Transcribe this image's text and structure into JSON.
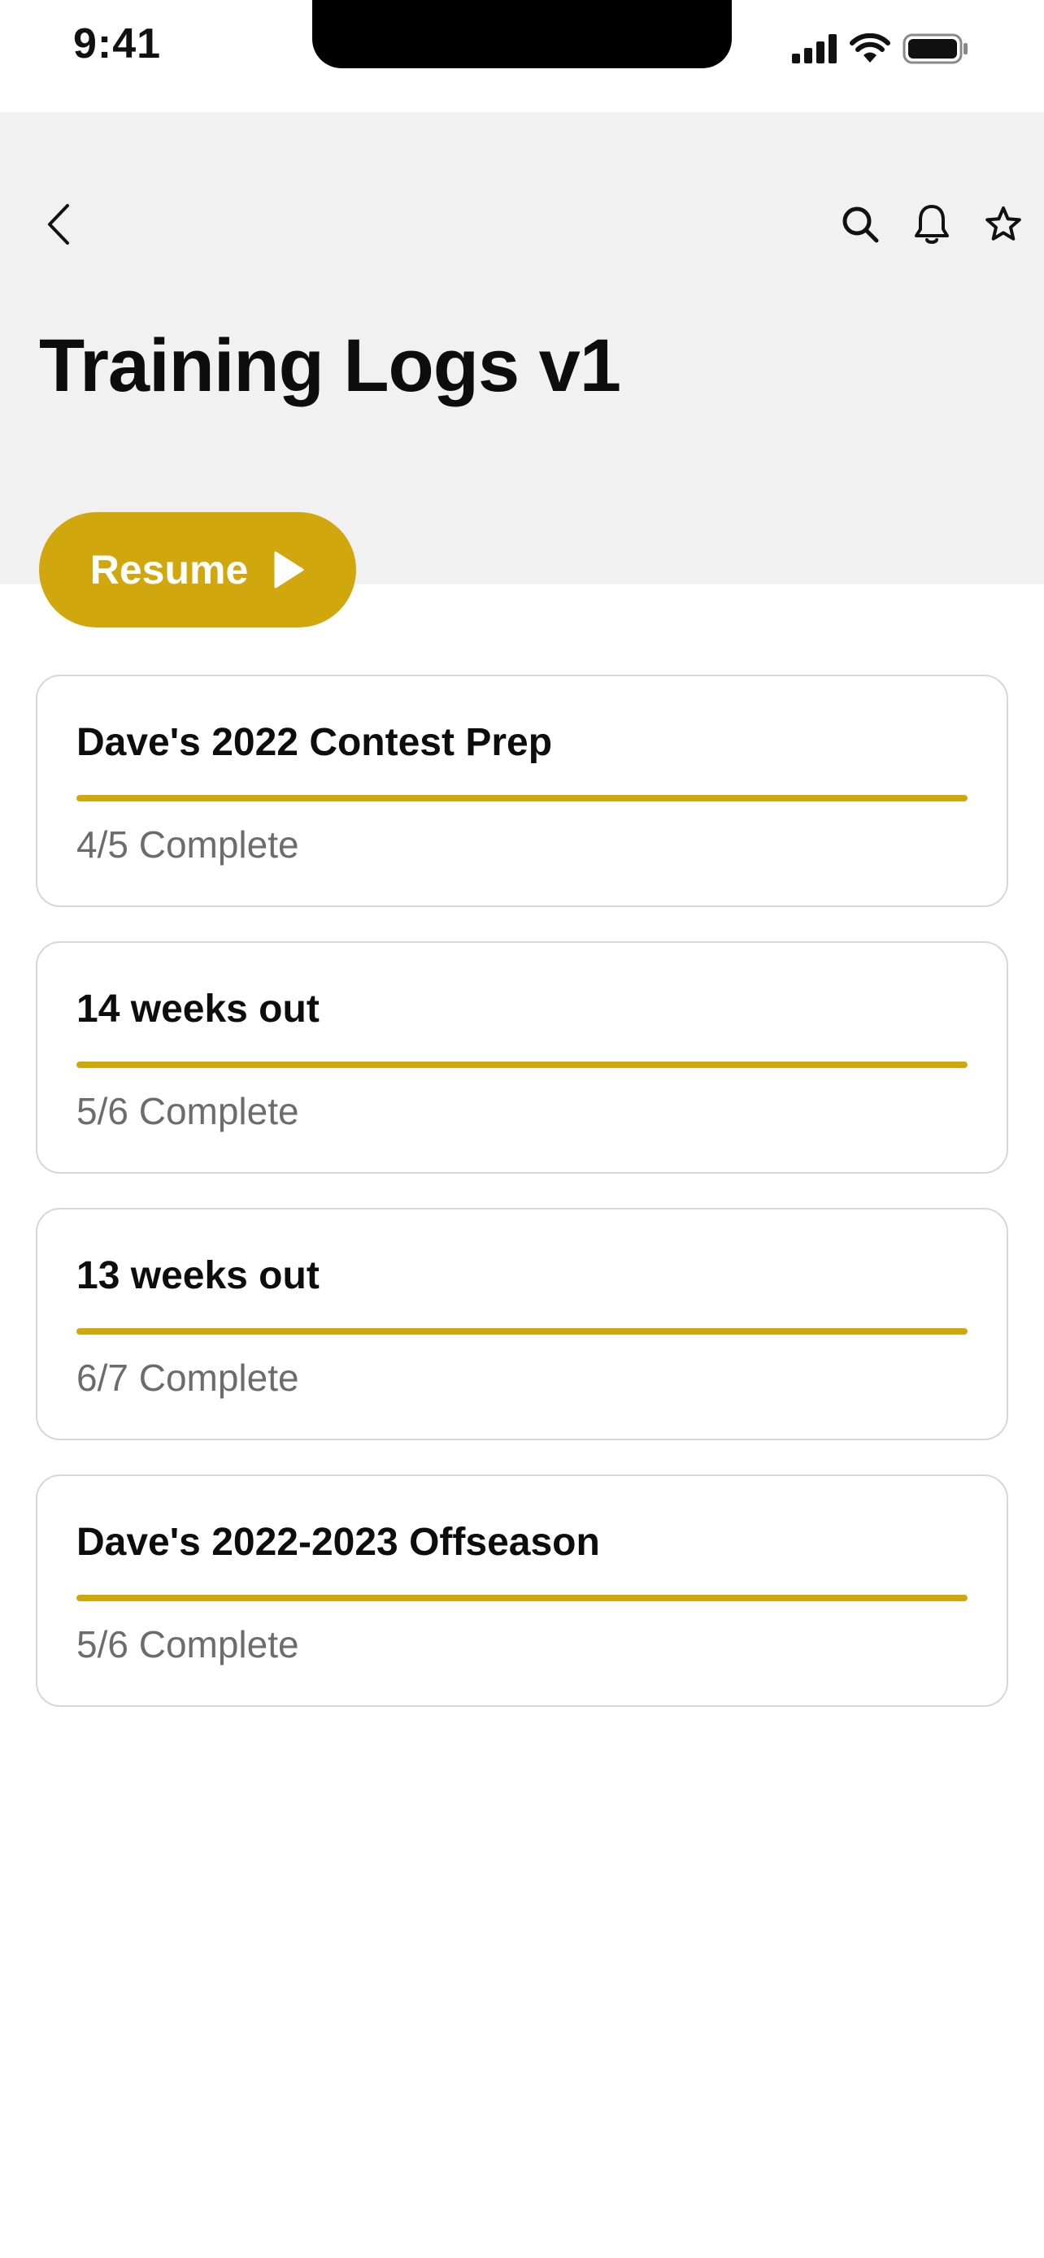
{
  "status_bar": {
    "time": "9:41"
  },
  "header": {
    "title": "Training Logs v1"
  },
  "resume": {
    "label": "Resume"
  },
  "colors": {
    "accent": "#d1a70e",
    "header_bg": "#f1f1f1",
    "muted_text": "#6c6c6c"
  },
  "icons": {
    "back": "chevron-left-icon",
    "search": "search-icon",
    "notifications": "bell-icon",
    "favorite": "star-icon",
    "resume": "play-icon"
  },
  "logs": [
    {
      "title": "Dave's 2022 Contest Prep",
      "status": "4/5 Complete",
      "progress": 1.0
    },
    {
      "title": "14 weeks out",
      "status": "5/6 Complete",
      "progress": 1.0
    },
    {
      "title": "13 weeks out",
      "status": "6/7 Complete",
      "progress": 1.0
    },
    {
      "title": "Dave's 2022-2023 Offseason",
      "status": "5/6 Complete",
      "progress": 1.0
    }
  ]
}
